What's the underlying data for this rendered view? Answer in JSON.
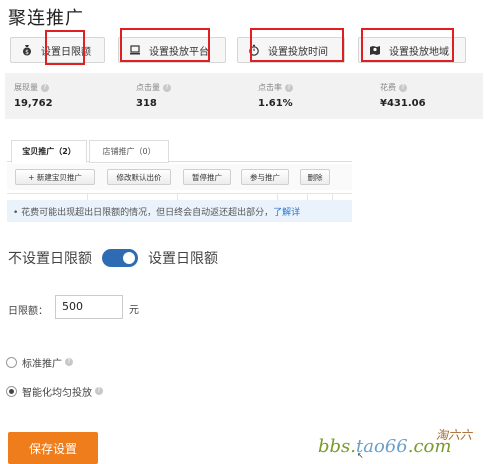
{
  "page_title": "聚连推广",
  "settings_buttons": [
    {
      "label": "设置日限额",
      "icon": "money-bag-icon"
    },
    {
      "label": "设置投放平台",
      "icon": "computer-icon"
    },
    {
      "label": "设置投放时间",
      "icon": "stopwatch-icon"
    },
    {
      "label": "设置投放地域",
      "icon": "map-icon"
    }
  ],
  "stats": [
    {
      "label": "展现量",
      "value": "19,762"
    },
    {
      "label": "点击量",
      "value": "318"
    },
    {
      "label": "点击率",
      "value": "1.61%"
    },
    {
      "label": "花费",
      "value": "¥431.06"
    }
  ],
  "tabs": [
    {
      "label": "宝贝推广（2）",
      "active": true
    },
    {
      "label": "店铺推广（0）",
      "active": false
    }
  ],
  "toolbar": [
    "+ 新建宝贝推广",
    "修改默认出价",
    "暂停推广",
    "参与推广",
    "删除"
  ],
  "notice": {
    "text": "• 花费可能出现超出日限额的情况，但日终会自动返还超出部分，",
    "link": "了解详"
  },
  "daily_limit": {
    "off_label": "不设置日限额",
    "on_label": "设置日限额",
    "enabled": true,
    "amount_label": "日限额：",
    "amount_value": "500",
    "unit": "元"
  },
  "delivery_options": [
    {
      "label": "标准推广",
      "checked": false
    },
    {
      "label": "智能化均匀投放",
      "checked": true
    }
  ],
  "save_label": "保存设置",
  "watermark": {
    "domain_prefix": "bbs.",
    "domain_accent": "tao66",
    "domain_suffix": ".com",
    "brand": "淘六六"
  },
  "colors": {
    "accent_orange": "#f07d1c",
    "toggle_blue": "#2f6bb3",
    "highlight_red": "#e02020",
    "link_blue": "#2d73c4"
  }
}
